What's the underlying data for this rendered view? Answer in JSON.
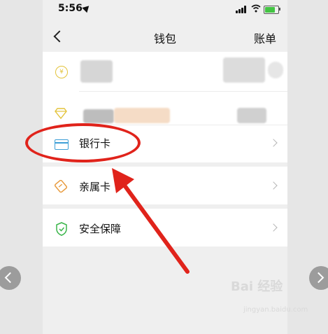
{
  "status_bar": {
    "time": "5:56"
  },
  "nav": {
    "title": "钱包",
    "right_label": "账单"
  },
  "rows": {
    "coin_symbol": "¥",
    "bank_card": "银行卡",
    "family_card": "亲属卡",
    "security": "安全保障"
  },
  "watermark": {
    "text": "Bai 经验",
    "sub": "jingyan.baidu.com"
  },
  "colors": {
    "highlight": "#e0231b",
    "card_icon": "#3e9fd6",
    "coin_icon": "#e3c33a",
    "family_icon": "#e89a3c",
    "shield_icon": "#3ab54a"
  },
  "icons": [
    "location-arrow-icon",
    "signal-icon",
    "wifi-icon",
    "battery-icon",
    "back-icon",
    "coin-icon",
    "diamond-icon",
    "bank-card-icon",
    "family-card-icon",
    "shield-icon",
    "chevron-right-icon"
  ]
}
